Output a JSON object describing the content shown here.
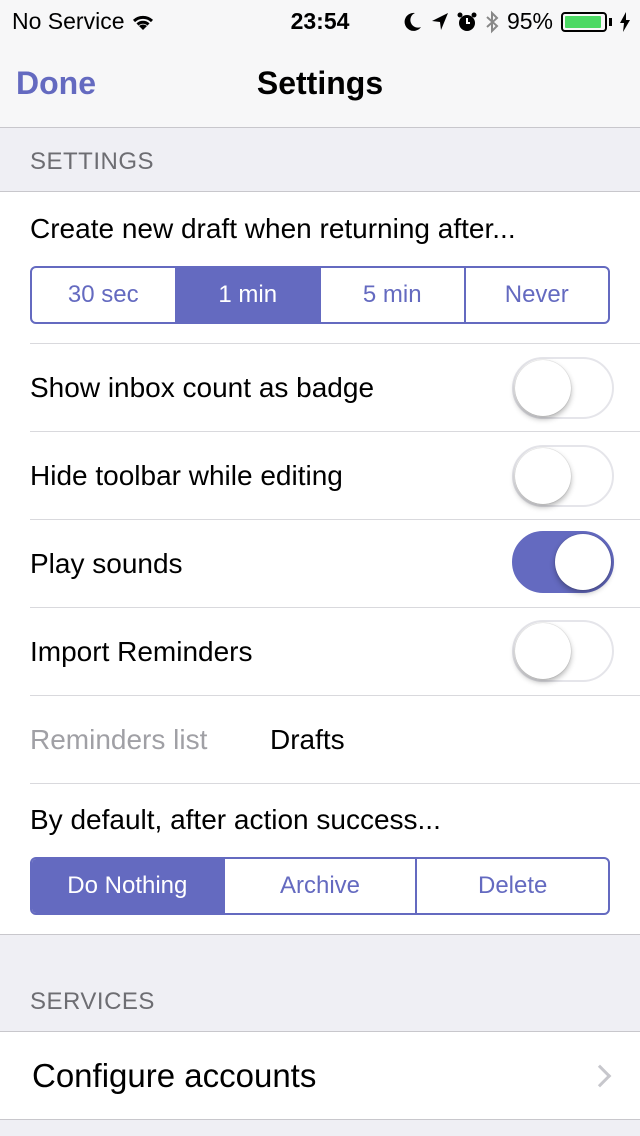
{
  "status_bar": {
    "carrier": "No Service",
    "time": "23:54",
    "battery_percent": "95%",
    "battery_level": 0.95,
    "icons": [
      "wifi-icon",
      "moon-icon",
      "location-icon",
      "alarm-icon",
      "bluetooth-icon",
      "battery-icon",
      "charging-icon"
    ]
  },
  "nav": {
    "done_label": "Done",
    "title": "Settings"
  },
  "settings_section": {
    "header": "SETTINGS",
    "draft_prompt": "Create new draft when returning after...",
    "draft_options": [
      "30 sec",
      "1 min",
      "5 min",
      "Never"
    ],
    "draft_selected": "1 min",
    "toggles": [
      {
        "label": "Show inbox count as badge",
        "on": false
      },
      {
        "label": "Hide toolbar while editing",
        "on": false
      },
      {
        "label": "Play sounds",
        "on": true
      },
      {
        "label": "Import Reminders",
        "on": false
      }
    ],
    "reminders_list_label": "Reminders list",
    "reminders_list_value": "Drafts",
    "action_prompt": "By default, after action success...",
    "action_options": [
      "Do Nothing",
      "Archive",
      "Delete"
    ],
    "action_selected": "Do Nothing"
  },
  "services_section": {
    "header": "SERVICES",
    "configure_label": "Configure accounts"
  },
  "colors": {
    "accent": "#646ac0",
    "background": "#efeff4",
    "secondary_text": "#6d6d72",
    "disabled_text": "#a0a0a5"
  }
}
